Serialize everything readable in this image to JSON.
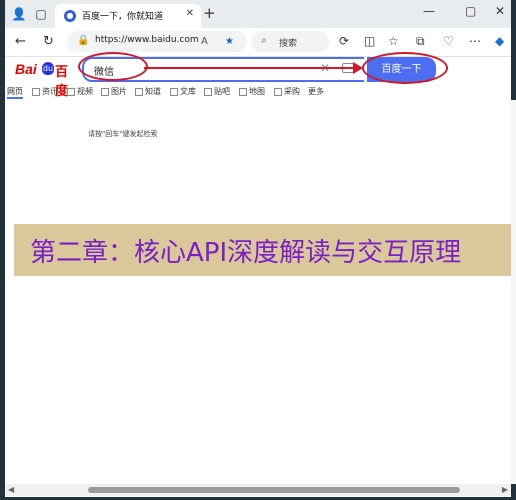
{
  "browser": {
    "tab_title": "百度一下，你就知道",
    "tab_favicon": "baidu-paw-icon",
    "url": "https://www.baidu.com",
    "search_placeholder": "搜索"
  },
  "page": {
    "logo": {
      "bai": "Bai",
      "du": "百度",
      "paw": "du"
    },
    "search_value": "微信",
    "search_button": "百度一下",
    "tabs": [
      "网页",
      "资讯",
      "视频",
      "图片",
      "知道",
      "文库",
      "贴吧",
      "地图",
      "采购",
      "更多"
    ],
    "hint": "请按\"回车\"键发起检索"
  },
  "overlay": {
    "banner_text": "第二章：核心API深度解读与交互原理",
    "banner_bg": "#dbc89a",
    "banner_color": "#7a1fc7",
    "annotation_color": "#d1192b"
  }
}
